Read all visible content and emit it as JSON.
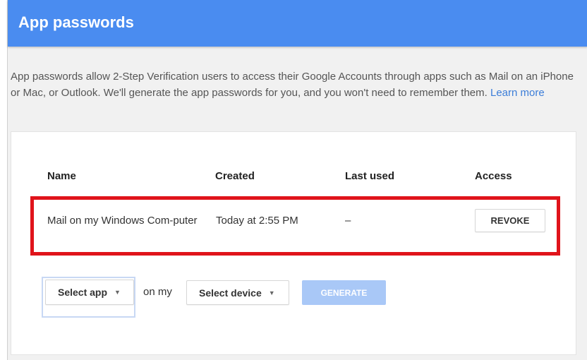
{
  "header": {
    "title": "App passwords"
  },
  "intro": {
    "text": "App passwords allow 2-Step Verification users to access their Google Accounts through apps such as Mail on an iPhone or Mac, or Outlook. We'll generate the app passwords for you, and you won't need to remember them.",
    "learn_more": "Learn more"
  },
  "table": {
    "columns": [
      "Name",
      "Created",
      "Last used",
      "Access"
    ],
    "rows": [
      {
        "name": "Mail on my Windows Com-puter",
        "created": "Today at 2:55 PM",
        "last_used": "–",
        "access_button": "REVOKE"
      }
    ]
  },
  "generator": {
    "select_app": "Select app",
    "on_my": "on my",
    "select_device": "Select device",
    "generate_button": "GENERATE"
  },
  "colors": {
    "header": "#4a8cf0",
    "highlight": "#e0141b",
    "link": "#3b7dd8",
    "generate_disabled": "#a9c8f7"
  }
}
